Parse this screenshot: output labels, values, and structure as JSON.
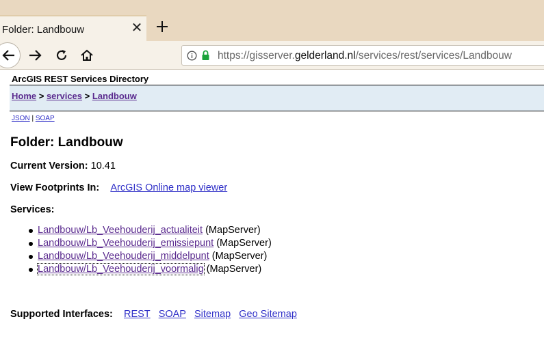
{
  "browser": {
    "tab": {
      "title": "Folder: Landbouw"
    },
    "url": {
      "prefix": "https://gisserver.",
      "host": "gelderland.nl",
      "path": "/services/rest/services/Landbouw"
    }
  },
  "page": {
    "header_title": "ArcGIS REST Services Directory",
    "breadcrumb": {
      "home": "Home",
      "sep1": " > ",
      "services": "services",
      "sep2": " > ",
      "current": "Landbouw"
    },
    "formats": {
      "json": "JSON",
      "sep": " | ",
      "soap": "SOAP"
    },
    "folder_title": "Folder: Landbouw",
    "current_version": {
      "label": "Current Version:",
      "value": "10.41"
    },
    "footprints": {
      "label": "View Footprints In:",
      "link": "ArcGIS Online map viewer"
    },
    "services_label": "Services:",
    "services": [
      {
        "name": "Landbouw/Lb_Veehouderij_actualiteit",
        "type": "(MapServer)"
      },
      {
        "name": "Landbouw/Lb_Veehouderij_emissiepunt",
        "type": "(MapServer)"
      },
      {
        "name": "Landbouw/Lb_Veehouderij_middelpunt",
        "type": "(MapServer)"
      },
      {
        "name": "Landbouw/Lb_Veehouderij_voormalig",
        "type": "(MapServer)"
      }
    ],
    "interfaces": {
      "label": "Supported Interfaces:",
      "links": [
        "REST",
        "SOAP",
        "Sitemap",
        "Geo Sitemap"
      ]
    }
  }
}
